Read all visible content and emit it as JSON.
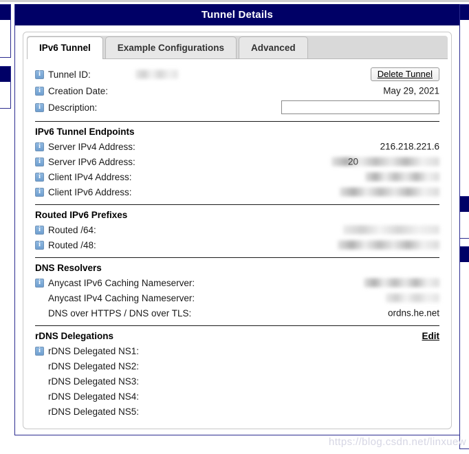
{
  "window": {
    "title": "Tunnel Details",
    "title_bg": "#000066",
    "title_fg": "#ffffff"
  },
  "tabs": [
    {
      "label": "IPv6 Tunnel",
      "active": true
    },
    {
      "label": "Example Configurations",
      "active": false
    },
    {
      "label": "Advanced",
      "active": false
    }
  ],
  "actions": {
    "delete_tunnel": "Delete Tunnel",
    "edit": "Edit"
  },
  "tunnel_info": {
    "tunnel_id_label": "Tunnel ID:",
    "tunnel_id_value": "",
    "creation_date_label": "Creation Date:",
    "creation_date_value": "May 29, 2021",
    "description_label": "Description:",
    "description_value": "",
    "description_placeholder": ""
  },
  "endpoints": {
    "title": "IPv6 Tunnel Endpoints",
    "rows": [
      {
        "label": "Server IPv4 Address:",
        "value": "216.218.221.6",
        "redacted": false
      },
      {
        "label": "Server IPv6 Address:",
        "value": "20",
        "redacted": true
      },
      {
        "label": "Client IPv4 Address:",
        "value": "",
        "redacted": true
      },
      {
        "label": "Client IPv6 Address:",
        "value": "",
        "redacted": true
      }
    ]
  },
  "prefixes": {
    "title": "Routed IPv6 Prefixes",
    "rows": [
      {
        "label": "Routed /64:",
        "value": "",
        "redacted": true
      },
      {
        "label": "Routed /48:",
        "value": "",
        "redacted": true
      }
    ]
  },
  "dns": {
    "title": "DNS Resolvers",
    "rows": [
      {
        "label": "Anycast IPv6 Caching Nameserver:",
        "value": "",
        "redacted": true
      },
      {
        "label": "Anycast IPv4 Caching Nameserver:",
        "value": "",
        "redacted": true
      },
      {
        "label": "DNS over HTTPS / DNS over TLS:",
        "value": "ordns.he.net",
        "redacted": false
      }
    ]
  },
  "rdns": {
    "title": "rDNS Delegations",
    "rows": [
      {
        "label": "rDNS Delegated NS1:",
        "value": ""
      },
      {
        "label": "rDNS Delegated NS2:",
        "value": ""
      },
      {
        "label": "rDNS Delegated NS3:",
        "value": ""
      },
      {
        "label": "rDNS Delegated NS4:",
        "value": ""
      },
      {
        "label": "rDNS Delegated NS5:",
        "value": ""
      }
    ]
  },
  "watermark": "https://blog.csdn.net/linxuew"
}
